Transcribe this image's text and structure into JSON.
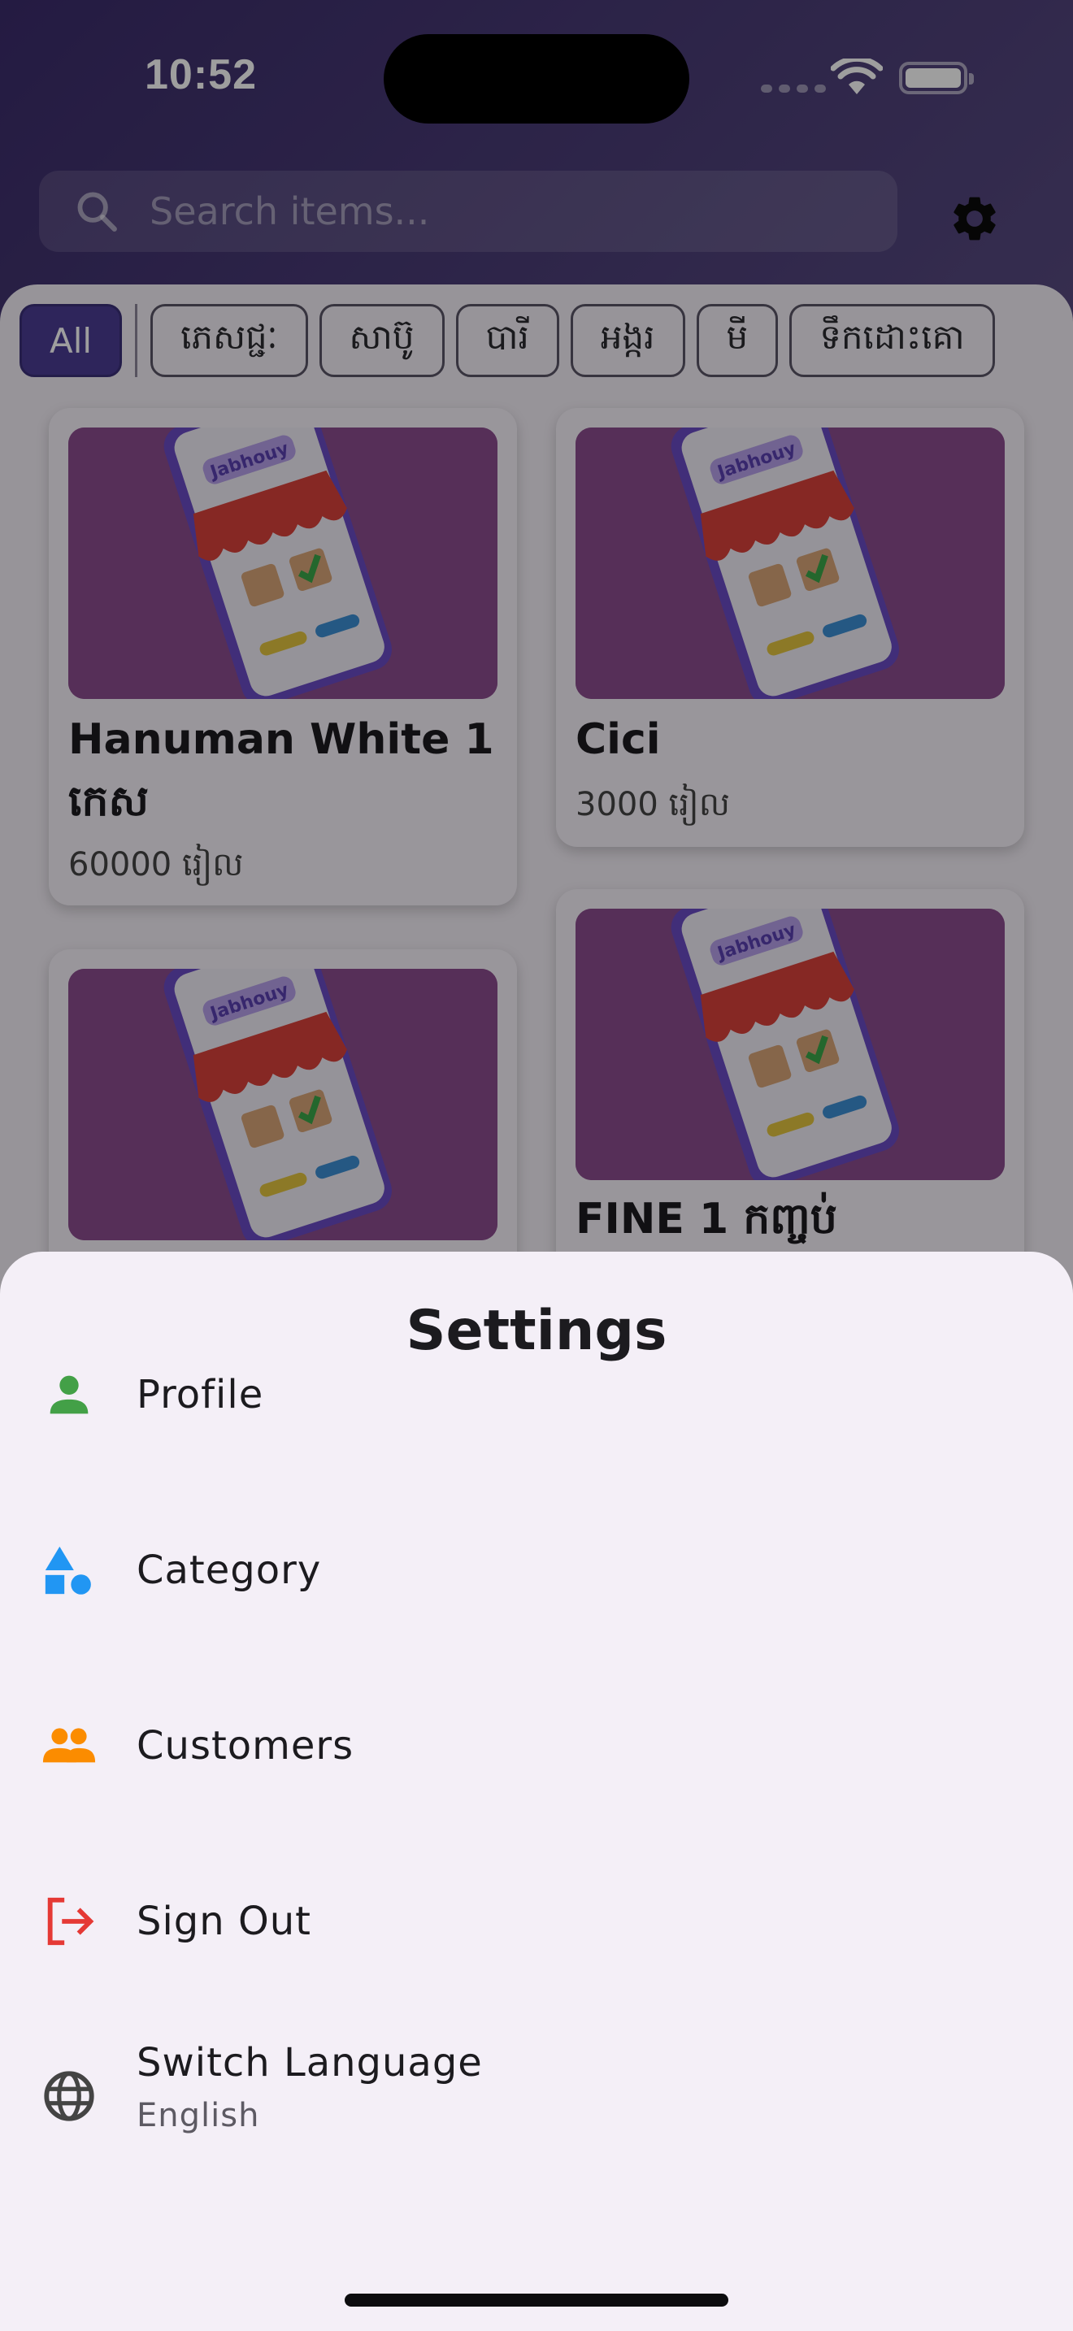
{
  "status_bar": {
    "time": "10:52"
  },
  "search": {
    "placeholder": "Search items..."
  },
  "icons": {
    "search": "search-icon",
    "settings": "gear-icon",
    "profile": "person-icon",
    "category": "category-shapes-icon",
    "customers": "people-icon",
    "sign_out": "logout-icon",
    "language": "globe-icon"
  },
  "categories": [
    "All",
    "ភេសជ្ជៈ",
    "សាប៊ូ",
    "បារី",
    "អង្ករ",
    "មី",
    "ទឹកដោះគោ"
  ],
  "selected_category": "All",
  "products": [
    {
      "name": "Hanuman White 1 កេស",
      "price": "60000 រៀល"
    },
    {
      "name": "Cici",
      "price": "3000 រៀល"
    },
    {
      "name": "",
      "price": ""
    },
    {
      "name": "FINE 1 កញ្ចប់",
      "price": ""
    }
  ],
  "thumbnail_brand": "Jabhouy",
  "settings_sheet": {
    "title": "Settings",
    "items": [
      {
        "label": "Profile"
      },
      {
        "label": "Category"
      },
      {
        "label": "Customers"
      },
      {
        "label": "Sign Out"
      },
      {
        "label": "Switch Language",
        "sublabel": "English"
      }
    ]
  },
  "colors": {
    "profile_icon": "#43a047",
    "category_icon": "#2196f3",
    "customers_icon": "#fb8c00",
    "sign_out_icon": "#e53935",
    "language_icon": "#444444",
    "chip_active": "#4b3c94"
  }
}
